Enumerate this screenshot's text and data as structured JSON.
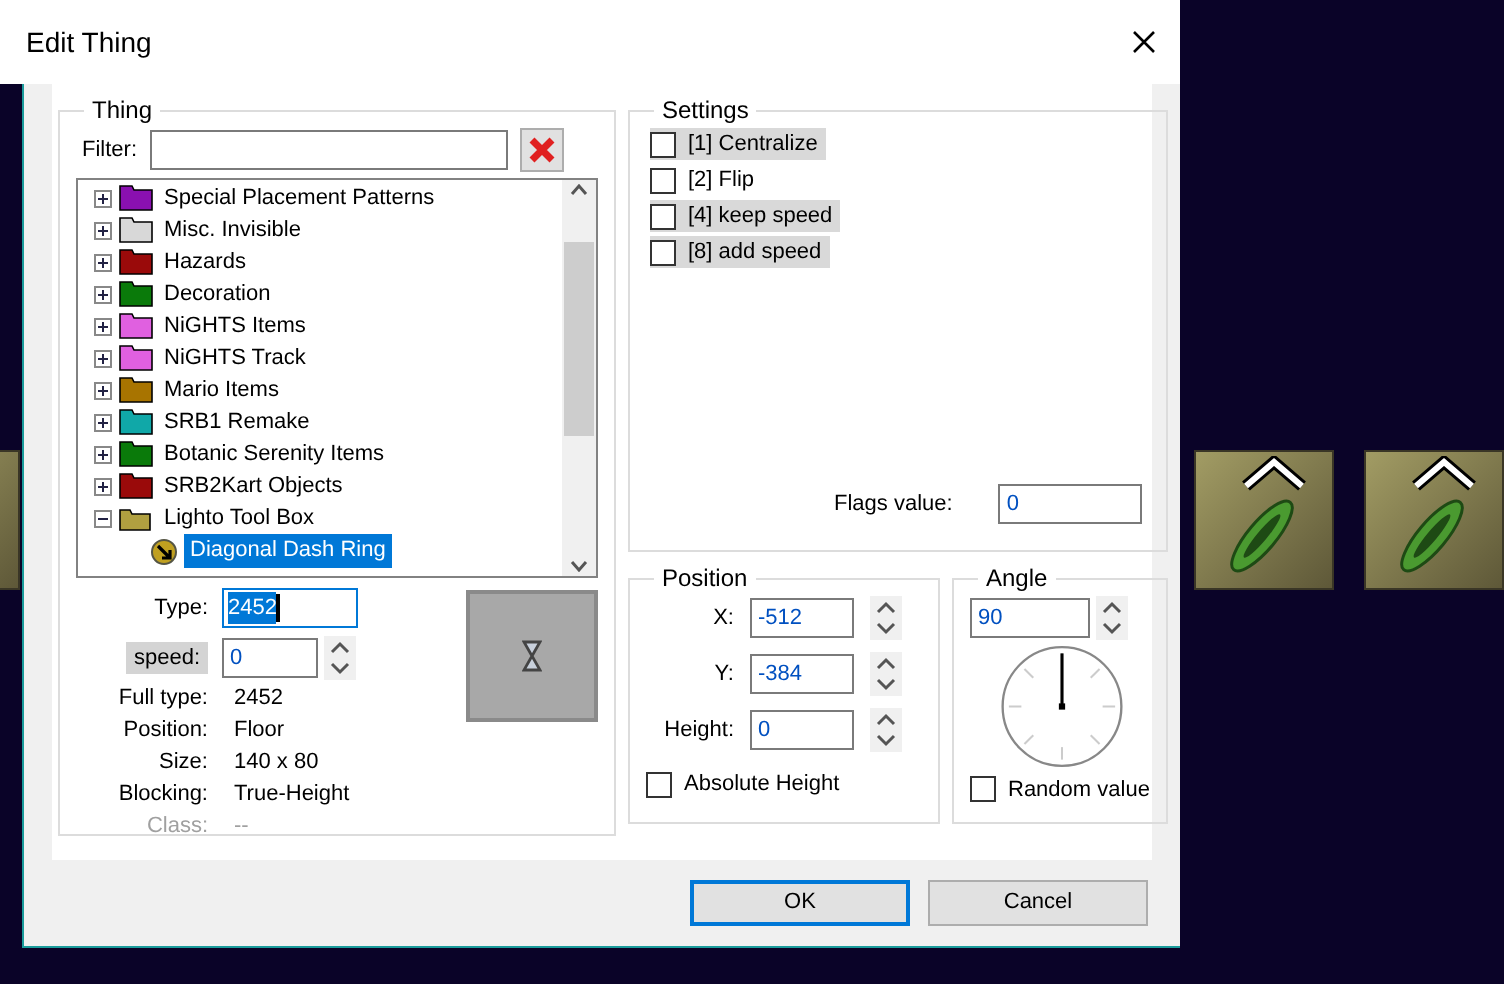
{
  "window": {
    "title": "Edit Thing"
  },
  "thing": {
    "title": "Thing",
    "filter_label": "Filter:",
    "tree": [
      {
        "label": "Special Placement Patterns",
        "color": "#8a10b0",
        "expanded": false,
        "selected": false
      },
      {
        "label": "Misc. Invisible",
        "color": "#d8d8d8",
        "expanded": false,
        "selected": false
      },
      {
        "label": "Hazards",
        "color": "#9a0a0a",
        "expanded": false,
        "selected": false
      },
      {
        "label": "Decoration",
        "color": "#0a7a0a",
        "expanded": false,
        "selected": false
      },
      {
        "label": "NiGHTS Items",
        "color": "#e060e0",
        "expanded": false,
        "selected": false
      },
      {
        "label": "NiGHTS Track",
        "color": "#e060e0",
        "expanded": false,
        "selected": false
      },
      {
        "label": "Mario Items",
        "color": "#a87400",
        "expanded": false,
        "selected": false
      },
      {
        "label": "SRB1 Remake",
        "color": "#10a8a8",
        "expanded": false,
        "selected": false
      },
      {
        "label": "Botanic Serenity Items",
        "color": "#0a7a0a",
        "expanded": false,
        "selected": false
      },
      {
        "label": "SRB2Kart Objects",
        "color": "#9a0a0a",
        "expanded": false,
        "selected": false
      },
      {
        "label": "Lighto Tool Box",
        "color": "#b0a040",
        "expanded": true,
        "selected": false,
        "children": [
          {
            "label": "Diagonal Dash Ring",
            "selected": true
          }
        ]
      }
    ],
    "type_label": "Type:",
    "type_value": "2452",
    "arg_label": "speed:",
    "arg_highlighted": true,
    "arg_value": "0",
    "info": [
      {
        "label": "Full type:",
        "value": "2452",
        "disabled": false
      },
      {
        "label": "Position:",
        "value": "Floor",
        "disabled": false
      },
      {
        "label": "Size:",
        "value": "140 x 80",
        "disabled": false
      },
      {
        "label": "Blocking:",
        "value": "True-Height",
        "disabled": false
      },
      {
        "label": "Class:",
        "value": "--",
        "disabled": true
      }
    ]
  },
  "settings": {
    "title": "Settings",
    "flags": [
      {
        "label": "[1] Centralize",
        "checked": false,
        "highlighted": true
      },
      {
        "label": "[2] Flip",
        "checked": false,
        "highlighted": false
      },
      {
        "label": "[4] keep speed",
        "checked": false,
        "highlighted": true
      },
      {
        "label": "[8] add speed",
        "checked": false,
        "highlighted": true
      }
    ],
    "flags_value_label": "Flags value:",
    "flags_value": "0"
  },
  "position": {
    "title": "Position",
    "fields": [
      {
        "label": "X:",
        "value": "-512"
      },
      {
        "label": "Y:",
        "value": "-384"
      },
      {
        "label": "Height:",
        "value": "0"
      }
    ],
    "absolute_height": {
      "label": "Absolute Height",
      "checked": false
    }
  },
  "angle": {
    "title": "Angle",
    "value": "90",
    "random": {
      "label": "Random value",
      "checked": false
    }
  },
  "buttons": [
    {
      "label": "OK",
      "default": true
    },
    {
      "label": "Cancel",
      "default": false
    }
  ]
}
